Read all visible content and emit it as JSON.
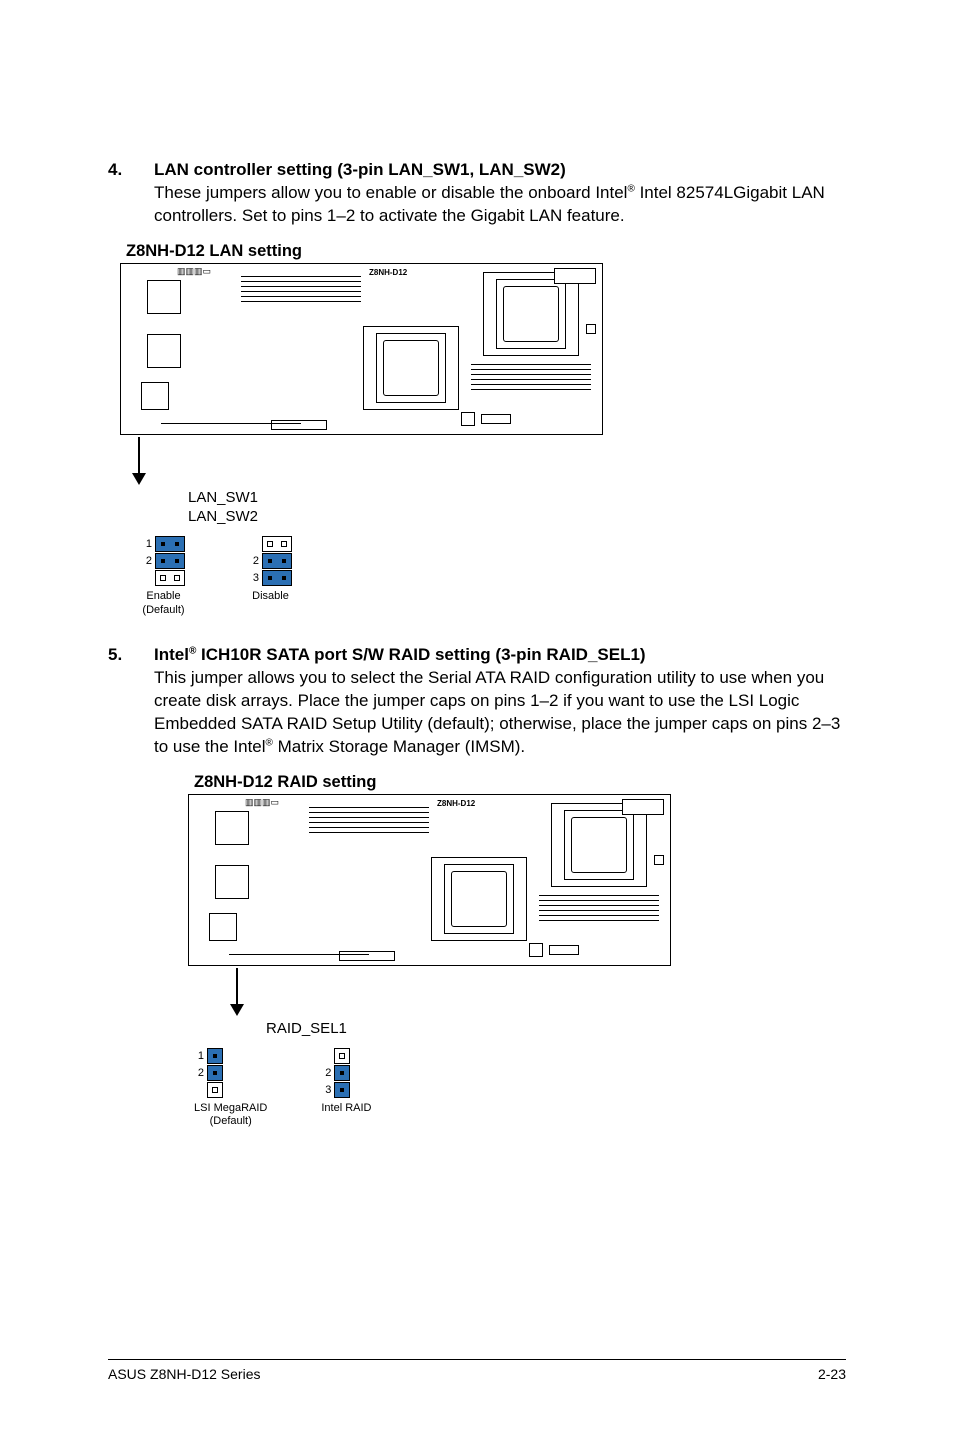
{
  "section4": {
    "num": "4.",
    "heading": "LAN controller setting (3-pin LAN_SW1, LAN_SW2)",
    "body_pre": "These jumpers allow you to enable or disable the onboard Intel",
    "body_sup": "®",
    "body_post": " Intel 82574LGigabit LAN controllers. Set to pins 1–2 to activate the Gigabit LAN feature.",
    "diagram_title": "Z8NH-D12 LAN setting",
    "board_label": "Z8NH-D12",
    "jumper_name1": "LAN_SW1",
    "jumper_name2": "LAN_SW2",
    "pin1": "1",
    "pin2": "2",
    "pin3": "3",
    "caption_left_a": "Enable",
    "caption_left_b": "(Default)",
    "caption_right": "Disable"
  },
  "section5": {
    "num": "5.",
    "heading_pre": "Intel",
    "heading_sup": "®",
    "heading_post": " ICH10R SATA port S/W RAID setting (3-pin RAID_SEL1)",
    "body_pre": "This jumper allows you to select the Serial ATA RAID configuration utility to use when you create disk arrays. Place the jumper caps on pins 1–2 if you want to use the LSI Logic Embedded SATA RAID Setup Utility (default); otherwise, place the jumper caps on pins 2–3 to use the Intel",
    "body_sup": "®",
    "body_post": " Matrix Storage Manager (IMSM).",
    "diagram_title": "Z8NH-D12 RAID setting",
    "board_label": "Z8NH-D12",
    "jumper_name": "RAID_SEL1",
    "pin1": "1",
    "pin2": "2",
    "pin3": "3",
    "caption_left_a": "LSI MegaRAID",
    "caption_left_b": "(Default)",
    "caption_right": "Intel RAID"
  },
  "footer": {
    "left": "ASUS Z8NH-D12 Series",
    "right": "2-23"
  }
}
